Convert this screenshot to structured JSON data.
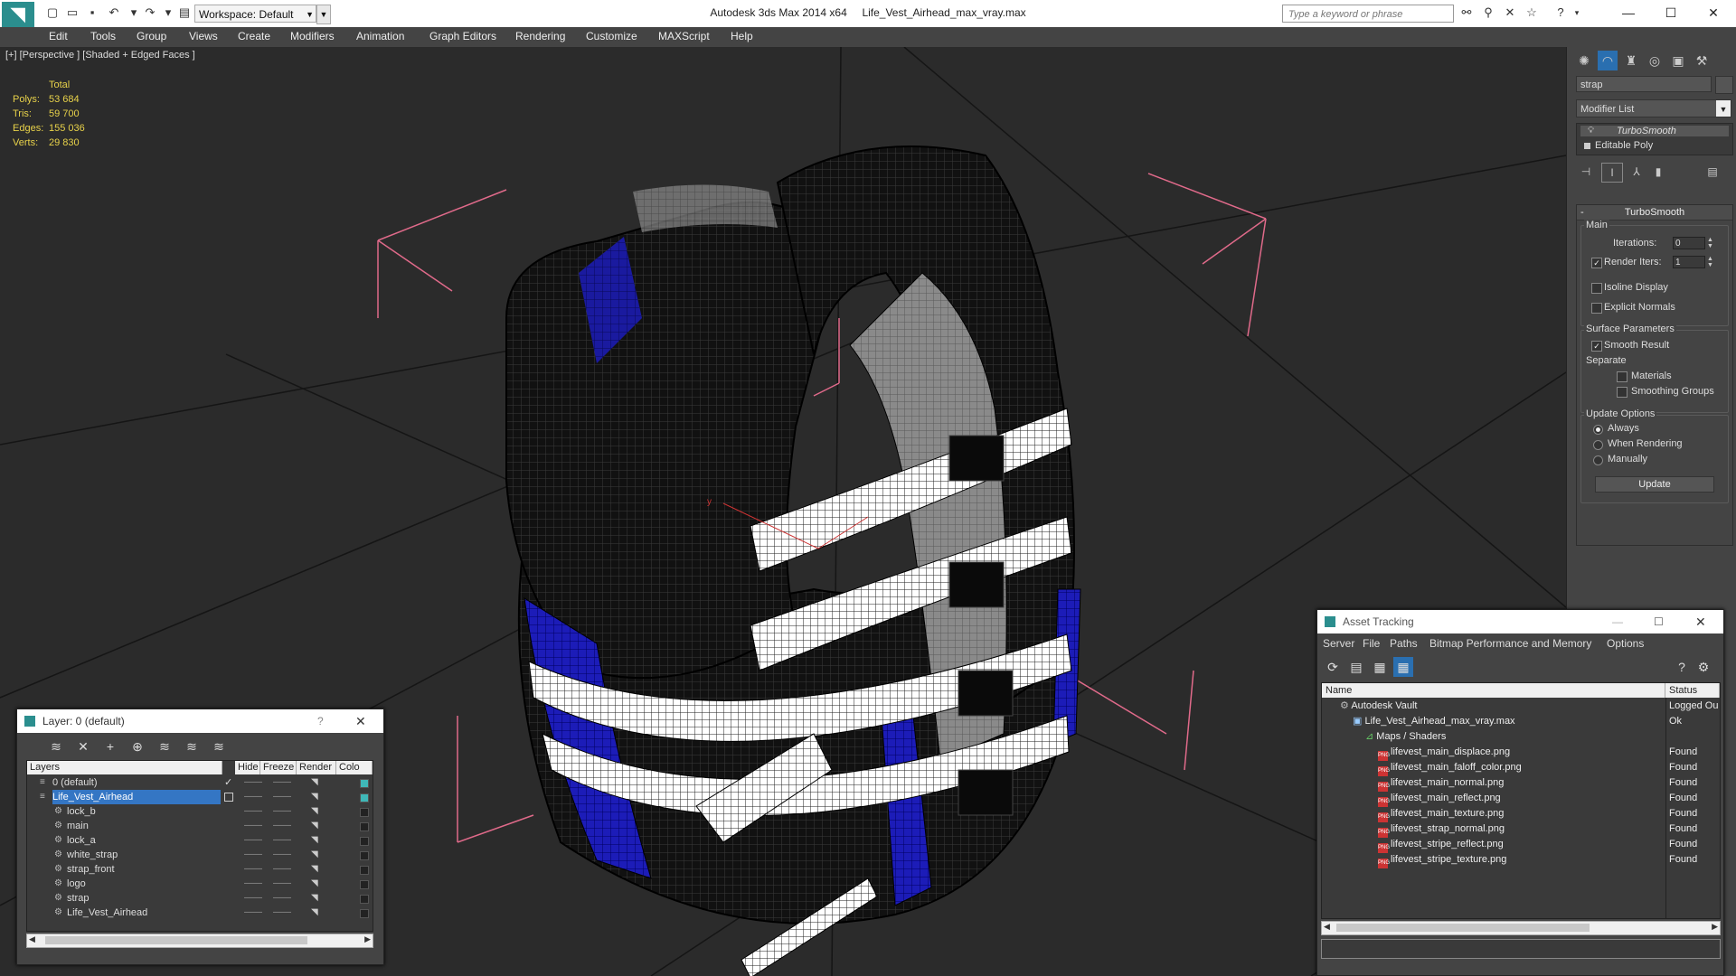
{
  "titlebar": {
    "workspace": "Workspace: Default",
    "app_title": "Autodesk 3ds Max  2014 x64",
    "file_title": "Life_Vest_Airhead_max_vray.max",
    "search_placeholder": "Type a keyword or phrase"
  },
  "menu": [
    "Edit",
    "Tools",
    "Group",
    "Views",
    "Create",
    "Modifiers",
    "Animation",
    "Graph Editors",
    "Rendering",
    "Customize",
    "MAXScript",
    "Help"
  ],
  "viewport": {
    "label": "[+] [Perspective ] [Shaded + Edged Faces ]",
    "stats": {
      "header": "Total",
      "rows": [
        {
          "label": "Polys:",
          "value": "53 684"
        },
        {
          "label": "Tris:",
          "value": "59 700"
        },
        {
          "label": "Edges:",
          "value": "155 036"
        },
        {
          "label": "Verts:",
          "value": "29 830"
        }
      ]
    },
    "axis_label": "y"
  },
  "command_panel": {
    "object_name": "strap",
    "modifier_list": "Modifier List",
    "stack": [
      "TurboSmooth",
      "Editable Poly"
    ],
    "rollout_title": "TurboSmooth",
    "main_label": "Main",
    "iterations_label": "Iterations:",
    "iterations_value": "0",
    "render_iters_label": "Render Iters:",
    "render_iters_value": "1",
    "isoline_display": "Isoline Display",
    "explicit_normals": "Explicit Normals",
    "surface_params": "Surface Parameters",
    "smooth_result": "Smooth Result",
    "separate": "Separate",
    "materials": "Materials",
    "smoothing_groups": "Smoothing Groups",
    "update_options": "Update Options",
    "always": "Always",
    "when_rendering": "When Rendering",
    "manually": "Manually",
    "update_button": "Update"
  },
  "layer_window": {
    "title": "Layer: 0 (default)",
    "help": "?",
    "columns": [
      "Layers",
      "Hide",
      "Freeze",
      "Render",
      "Colo"
    ],
    "rows": [
      {
        "name": "0 (default)",
        "level": 0,
        "selected": false
      },
      {
        "name": "Life_Vest_Airhead",
        "level": 0,
        "selected": true
      },
      {
        "name": "lock_b",
        "level": 1,
        "selected": false
      },
      {
        "name": "main",
        "level": 1,
        "selected": false
      },
      {
        "name": "lock_a",
        "level": 1,
        "selected": false
      },
      {
        "name": "white_strap",
        "level": 1,
        "selected": false
      },
      {
        "name": "strap_front",
        "level": 1,
        "selected": false
      },
      {
        "name": "logo",
        "level": 1,
        "selected": false
      },
      {
        "name": "strap",
        "level": 1,
        "selected": false
      },
      {
        "name": "Life_Vest_Airhead",
        "level": 1,
        "selected": false
      }
    ]
  },
  "asset_window": {
    "title": "Asset Tracking",
    "menu": [
      "Server",
      "File",
      "Paths",
      "Bitmap Performance and Memory",
      "Options"
    ],
    "columns": [
      "Name",
      "Status"
    ],
    "rows": [
      {
        "name": "Autodesk Vault",
        "status": "Logged Ou",
        "level": 0,
        "icon": "vault-icon"
      },
      {
        "name": "Life_Vest_Airhead_max_vray.max",
        "status": "Ok",
        "level": 1,
        "icon": "max-file-icon"
      },
      {
        "name": "Maps / Shaders",
        "status": "",
        "level": 2,
        "icon": "maps-icon"
      },
      {
        "name": "lifevest_main_displace.png",
        "status": "Found",
        "level": 3,
        "icon": "png-icon"
      },
      {
        "name": "lifevest_main_faloff_color.png",
        "status": "Found",
        "level": 3,
        "icon": "png-icon"
      },
      {
        "name": "lifevest_main_normal.png",
        "status": "Found",
        "level": 3,
        "icon": "png-icon"
      },
      {
        "name": "lifevest_main_reflect.png",
        "status": "Found",
        "level": 3,
        "icon": "png-icon"
      },
      {
        "name": "lifevest_main_texture.png",
        "status": "Found",
        "level": 3,
        "icon": "png-icon"
      },
      {
        "name": "lifevest_strap_normal.png",
        "status": "Found",
        "level": 3,
        "icon": "png-icon"
      },
      {
        "name": "lifevest_stripe_reflect.png",
        "status": "Found",
        "level": 3,
        "icon": "png-icon"
      },
      {
        "name": "lifevest_stripe_texture.png",
        "status": "Found",
        "level": 3,
        "icon": "png-icon"
      }
    ]
  },
  "colors": {
    "stats_text": "#e8d24a",
    "selection": "#3476c4",
    "vest_blue": "#1c1cb8",
    "grid_line": "#111111",
    "bbox_pink": "#e06a8a"
  }
}
